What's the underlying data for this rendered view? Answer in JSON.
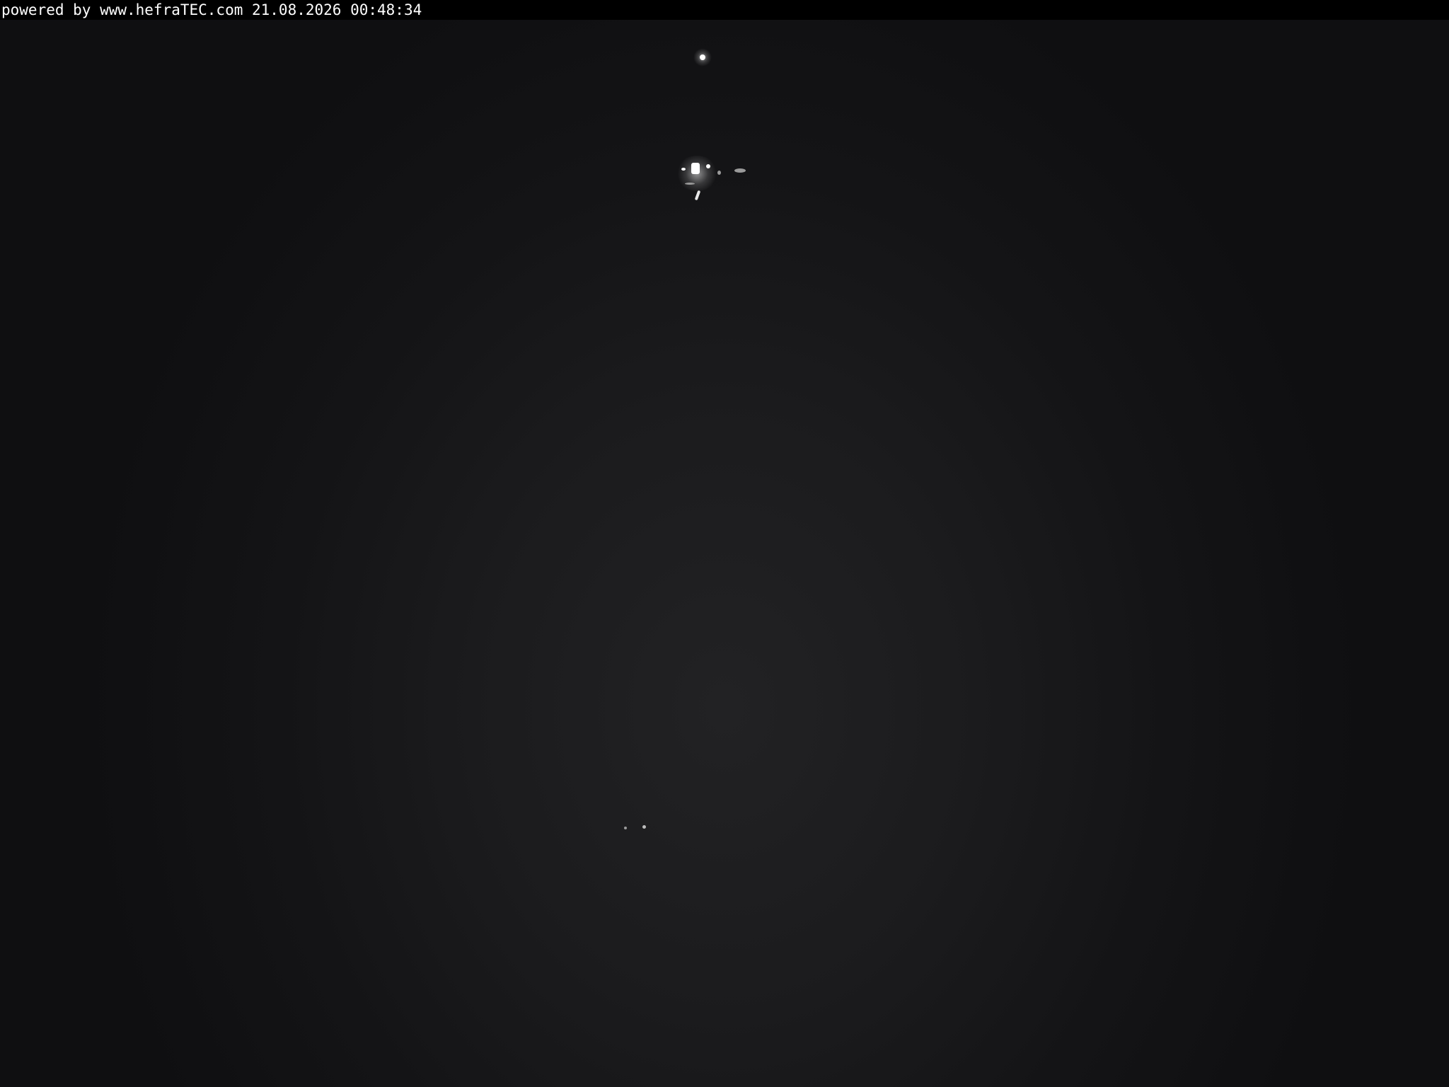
{
  "overlay": {
    "caption": "powered by www.hefraTEC.com 21.08.2026 00:48:34"
  },
  "colors": {
    "header_background": "#000000",
    "header_text": "#ffffff",
    "sky": "#1b1b1d"
  }
}
